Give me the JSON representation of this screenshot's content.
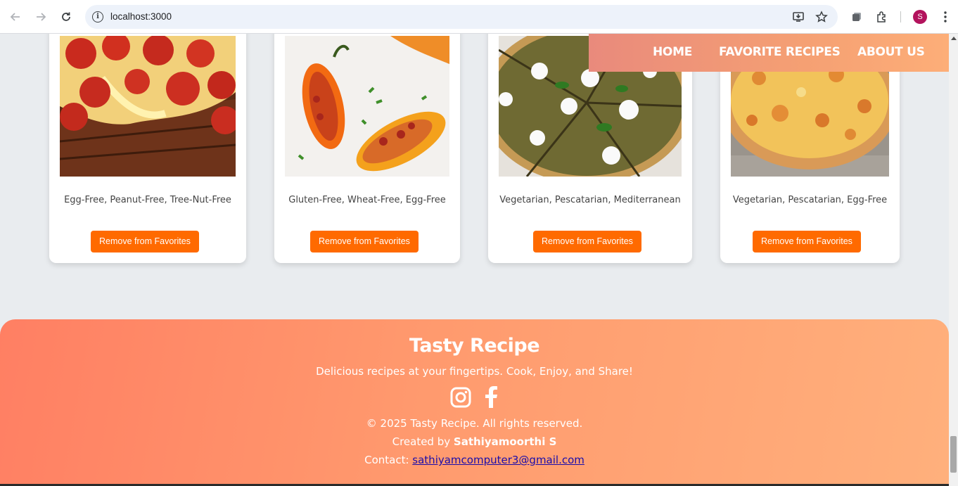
{
  "browser": {
    "url": "localhost:3000",
    "avatar_letter": "S",
    "avatar_color": "#b3135d"
  },
  "nav": {
    "items": [
      "HOME",
      "FAVORITE RECIPES",
      "ABOUT US"
    ]
  },
  "cards": [
    {
      "tags": "Egg-Free, Peanut-Free, Tree-Nut-Free",
      "button": "Remove from Favorites",
      "image": "pepperoni-pizza"
    },
    {
      "tags": "Gluten-Free, Wheat-Free, Egg-Free",
      "button": "Remove from Favorites",
      "image": "stuffed-peppers"
    },
    {
      "tags": "Vegetarian, Pescatarian, Mediterranean",
      "button": "Remove from Favorites",
      "image": "pesto-pizza"
    },
    {
      "tags": "Vegetarian, Pescatarian, Egg-Free",
      "button": "Remove from Favorites",
      "image": "cheese-pizza"
    }
  ],
  "footer": {
    "title": "Tasty Recipe",
    "tagline": "Delicious recipes at your fingertips. Cook, Enjoy, and Share!",
    "social_icons": [
      "instagram-icon",
      "facebook-icon"
    ],
    "copyright": "© 2025 Tasty Recipe. All rights reserved.",
    "created_prefix": "Created by ",
    "created_name": "Sathiyamoorthi S",
    "contact_prefix": "Contact: ",
    "contact_email": "sathiyamcomputer3@gmail.com"
  },
  "colors": {
    "accent_button": "#ff6a00",
    "footer_gradient_start": "#ff7f63",
    "footer_gradient_end": "#ffb07c",
    "page_bg": "#e9ecef"
  }
}
